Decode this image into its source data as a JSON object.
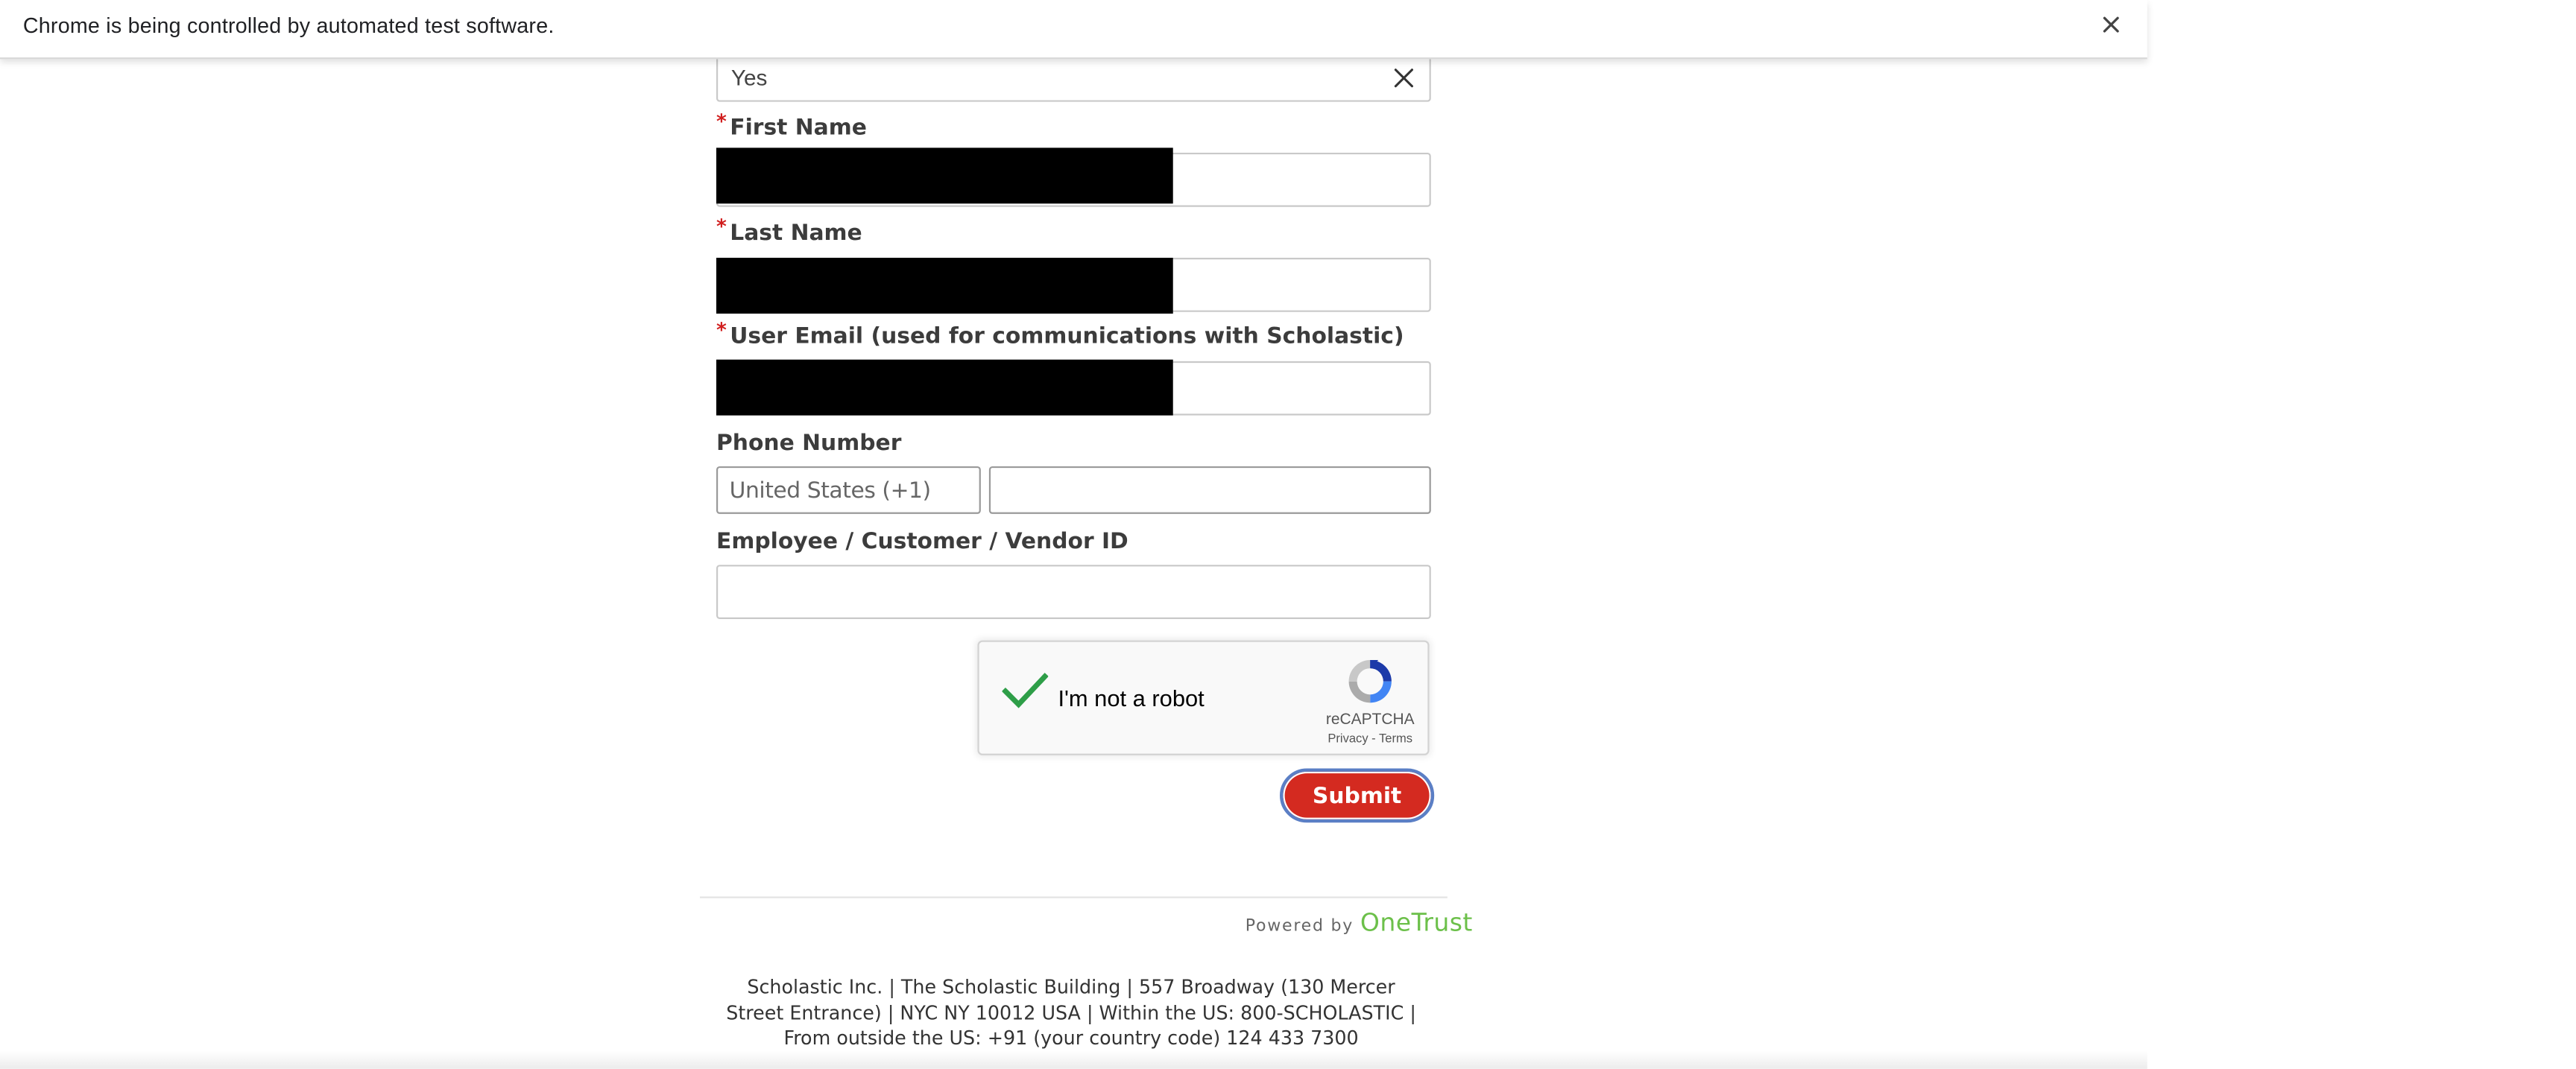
{
  "infobar": {
    "message": "Chrome is being controlled by automated test software.",
    "close_icon": "close-icon"
  },
  "form": {
    "select_field": {
      "value": "Yes",
      "clear_icon": "close-icon"
    },
    "first_name": {
      "label": "First Name",
      "required_mark": "*",
      "value": ""
    },
    "last_name": {
      "label": "Last Name",
      "required_mark": "*",
      "value": ""
    },
    "user_email": {
      "label": "User Email (used for communications with Scholastic)",
      "required_mark": "*",
      "value": ""
    },
    "phone": {
      "label": "Phone Number",
      "country": "United States (+1)",
      "number": ""
    },
    "vendor_id": {
      "label": "Employee / Customer / Vendor ID",
      "value": ""
    },
    "recaptcha": {
      "text": "I'm not a robot",
      "brand": "reCAPTCHA",
      "links": "Privacy - Terms",
      "checked": true,
      "check_color": "#2e9e48"
    },
    "submit_label": "Submit"
  },
  "powered_by": {
    "prefix": "Powered by",
    "brand": "OneTrust",
    "brand_color": "#6cc04a"
  },
  "footer": {
    "address": "Scholastic Inc. | The Scholastic Building | 557 Broadway (130 Mercer Street Entrance) | NYC NY 10012 USA | Within the US: 800-SCHOLASTIC | From outside the US: +91 (your country code) 124 433 7300"
  },
  "colors": {
    "accent_red": "#d42a20",
    "required_red": "#d11f1f",
    "focus_ring": "#5b7fc5"
  }
}
